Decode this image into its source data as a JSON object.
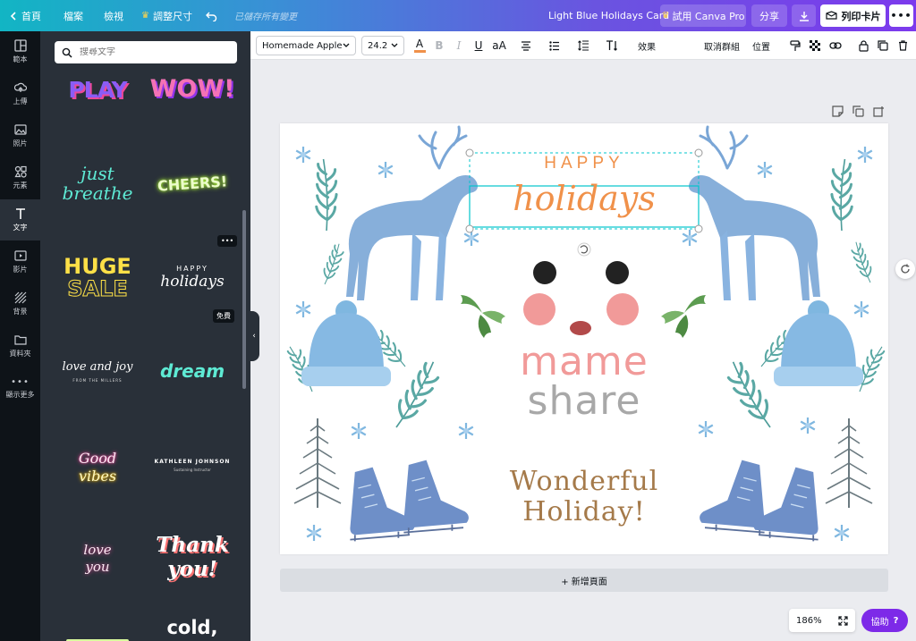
{
  "topbar": {
    "home": "首頁",
    "file": "檔案",
    "view": "檢視",
    "resize": "調整尺寸",
    "saved": "已儲存所有變更",
    "doc_title": "Light Blue Holidays Card",
    "try_pro": "試用 Canva Pro",
    "share": "分享",
    "print": "列印卡片"
  },
  "rail": {
    "items": [
      {
        "label": "範本"
      },
      {
        "label": "上傳"
      },
      {
        "label": "照片"
      },
      {
        "label": "元素"
      },
      {
        "label": "文字"
      },
      {
        "label": "影片"
      },
      {
        "label": "背景"
      },
      {
        "label": "資料夾"
      },
      {
        "label": "顯示更多"
      }
    ]
  },
  "panel": {
    "search_placeholder": "搜尋文字",
    "tiles": {
      "play": "PLAY",
      "wow": "WOW!",
      "just": "just",
      "breathe": "breathe",
      "cheers": "CHEERS!",
      "huge": "HUGE",
      "sale": "SALE",
      "happy": "HAPPY",
      "holidays": "holidays",
      "love_joy": "love and joy",
      "from_millers": "FROM THE MILLERS",
      "dream": "dream",
      "good": "Good",
      "vibes": "vibes",
      "kathleen": "KATHLEEN JOHNSON",
      "kathleen_sub": "Sustaining Instructor",
      "love": "love",
      "you": "you",
      "thank": "Thank",
      "you_excl": "you!",
      "cold": "cold,",
      "free_badge": "免費",
      "more_badge": "•••"
    }
  },
  "toolbar": {
    "font": "Homemade Apple",
    "size": "24.2",
    "effects": "效果",
    "ungroup": "取消群組",
    "position": "位置"
  },
  "canvas": {
    "happy": "HAPPY",
    "holidays": "holidays",
    "brand_line1": "mame",
    "brand_line2": "share",
    "wonderful": "Wonderful",
    "holiday": "Holiday!"
  },
  "footer": {
    "add_page": "+ 新增頁面",
    "zoom": "186%",
    "help": "協助"
  },
  "colors": {
    "accent_purple": "#7d2ae8",
    "deer_blue": "#7aa6d6",
    "orange_text": "#f0914a",
    "brown_text": "#a57a4a"
  }
}
